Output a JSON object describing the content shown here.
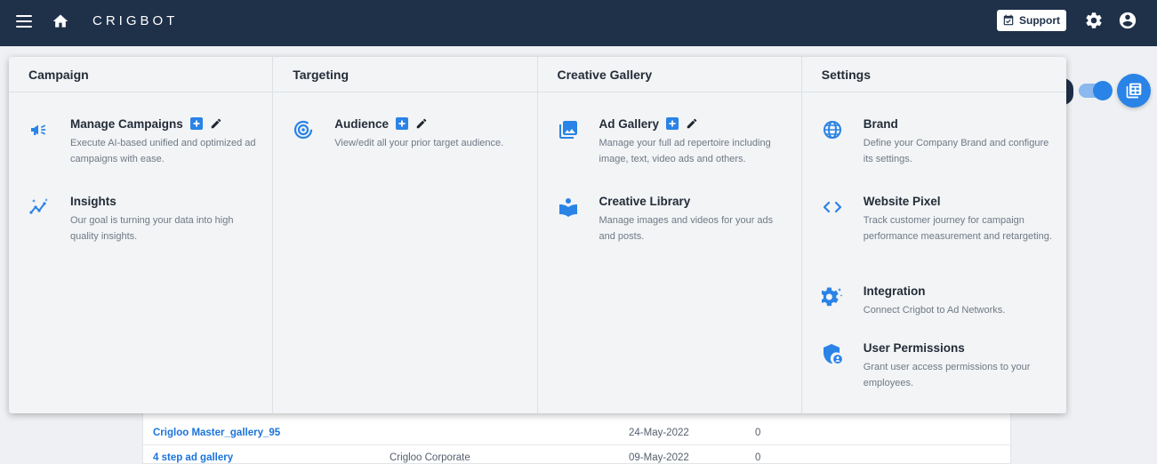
{
  "header": {
    "brand": "CRIGBOT",
    "support_label": "Support"
  },
  "colors": {
    "navbar": "#1f3049",
    "accent": "#2a83e6",
    "link": "#1a73d9"
  },
  "menu": {
    "columns": [
      {
        "heading": "Campaign",
        "items": [
          {
            "title": "Manage Campaigns",
            "desc": "Execute AI-based unified and optimized ad campaigns with ease.",
            "icon": "megaphone-icon",
            "actions": true
          },
          {
            "title": "Insights",
            "desc": "Our goal is turning your data into high quality insights.",
            "icon": "insights-icon"
          }
        ]
      },
      {
        "heading": "Targeting",
        "items": [
          {
            "title": "Audience",
            "desc": "View/edit all your prior target audience.",
            "icon": "target-icon",
            "actions": true
          }
        ]
      },
      {
        "heading": "Creative Gallery",
        "items": [
          {
            "title": "Ad Gallery",
            "desc": "Manage your full ad repertoire including image, text, video ads and others.",
            "icon": "gallery-icon",
            "actions": true
          },
          {
            "title": "Creative Library",
            "desc": "Manage images and videos for your ads and posts.",
            "icon": "book-icon"
          }
        ]
      },
      {
        "heading": "Settings",
        "items": [
          {
            "title": "Brand",
            "desc": "Define your Company Brand and configure its settings.",
            "icon": "globe-icon"
          },
          {
            "title": "Website Pixel",
            "desc": "Track customer journey for campaign performance measurement and retargeting.",
            "icon": "code-icon"
          },
          {
            "title": "Integration",
            "desc": "Connect Crigbot to Ad Networks.",
            "icon": "settings-cogs-icon"
          },
          {
            "title": "User Permissions",
            "desc": "Grant user access permissions to your employees.",
            "icon": "shield-user-icon"
          }
        ]
      }
    ]
  },
  "table": {
    "rows": [
      {
        "name": "Crigloo Master_gallery_95",
        "owner": "",
        "date": "24-May-2022",
        "count": "0"
      },
      {
        "name": "4 step ad gallery",
        "owner": "Crigloo Corporate",
        "date": "09-May-2022",
        "count": "0"
      }
    ]
  }
}
